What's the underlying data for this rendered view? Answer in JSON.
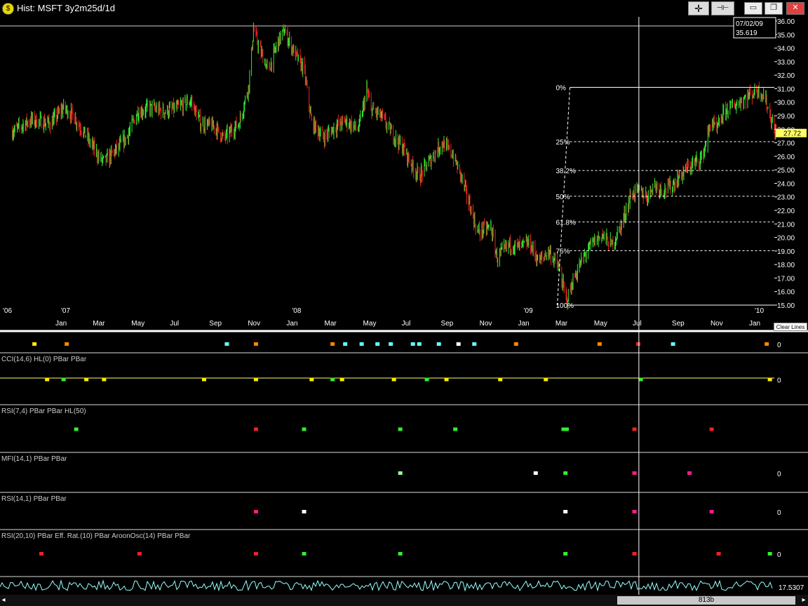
{
  "window": {
    "title": "Hist: MSFT 3y2m25d/1d",
    "btn_crosshair": "✛",
    "btn_pin": "⊣⊢",
    "btn_min": "▭",
    "btn_restore": "❐",
    "btn_close": "✕"
  },
  "cursor": {
    "date": "07/02/09",
    "value": "35.619"
  },
  "clear_lines_label": "Clear Lines",
  "scroll": {
    "left_arrow": "◂",
    "right_arrow": "▸",
    "bar_count": "813b"
  },
  "colors": {
    "up": "#33ee33",
    "down": "#ee2222",
    "price_label": "#ffff66",
    "grid": "#ffffff"
  },
  "chart_data": [
    {
      "type": "candlestick",
      "title": "",
      "series": [
        {
          "name": "MSFT",
          "points": [
            [
              "2006-10-15",
              27.8
            ],
            [
              "2006-11-15",
              28.7
            ],
            [
              "2006-12-15",
              28.4
            ],
            [
              "2007-01-05",
              29.6
            ],
            [
              "2007-01-20",
              29.0
            ],
            [
              "2007-02-10",
              27.5
            ],
            [
              "2007-03-01",
              26.0
            ],
            [
              "2007-03-10",
              25.6
            ],
            [
              "2007-04-01",
              26.6
            ],
            [
              "2007-04-15",
              27.4
            ],
            [
              "2007-05-01",
              29.2
            ],
            [
              "2007-05-20",
              29.6
            ],
            [
              "2007-06-15",
              29.3
            ],
            [
              "2007-07-05",
              29.6
            ],
            [
              "2007-07-25",
              30.1
            ],
            [
              "2007-08-10",
              28.4
            ],
            [
              "2007-09-01",
              28.2
            ],
            [
              "2007-09-15",
              27.3
            ],
            [
              "2007-10-10",
              28.5
            ],
            [
              "2007-10-25",
              31.3
            ],
            [
              "2007-11-01",
              35.4
            ],
            [
              "2007-11-10",
              34.0
            ],
            [
              "2007-11-25",
              32.3
            ],
            [
              "2007-12-10",
              34.5
            ],
            [
              "2007-12-20",
              35.3
            ],
            [
              "2008-01-05",
              33.6
            ],
            [
              "2008-01-20",
              32.4
            ],
            [
              "2008-02-01",
              28.5
            ],
            [
              "2008-02-20",
              27.4
            ],
            [
              "2008-03-10",
              28.2
            ],
            [
              "2008-03-25",
              28.6
            ],
            [
              "2008-04-15",
              28.0
            ],
            [
              "2008-04-28",
              30.9
            ],
            [
              "2008-05-05",
              29.5
            ],
            [
              "2008-05-20",
              29.0
            ],
            [
              "2008-06-10",
              27.5
            ],
            [
              "2008-06-25",
              26.6
            ],
            [
              "2008-07-10",
              25.2
            ],
            [
              "2008-07-20",
              24.5
            ],
            [
              "2008-08-10",
              26.0
            ],
            [
              "2008-08-25",
              27.0
            ],
            [
              "2008-09-10",
              26.2
            ],
            [
              "2008-09-25",
              24.4
            ],
            [
              "2008-10-10",
              22.0
            ],
            [
              "2008-10-20",
              20.4
            ],
            [
              "2008-11-10",
              20.8
            ],
            [
              "2008-11-20",
              18.5
            ],
            [
              "2008-12-10",
              19.5
            ],
            [
              "2008-12-25",
              19.3
            ],
            [
              "2009-01-10",
              19.6
            ],
            [
              "2009-01-25",
              18.2
            ],
            [
              "2009-02-10",
              19.0
            ],
            [
              "2009-02-25",
              17.8
            ],
            [
              "2009-03-10",
              15.3
            ],
            [
              "2009-03-20",
              16.8
            ],
            [
              "2009-04-05",
              18.5
            ],
            [
              "2009-04-20",
              19.6
            ],
            [
              "2009-05-05",
              20.2
            ],
            [
              "2009-05-20",
              19.4
            ],
            [
              "2009-06-05",
              21.0
            ],
            [
              "2009-06-20",
              23.2
            ],
            [
              "2009-07-02",
              23.5
            ],
            [
              "2009-07-15",
              23.0
            ],
            [
              "2009-07-25",
              23.9
            ],
            [
              "2009-08-10",
              23.5
            ],
            [
              "2009-08-25",
              23.9
            ],
            [
              "2009-09-10",
              24.8
            ],
            [
              "2009-09-25",
              25.4
            ],
            [
              "2009-10-10",
              25.9
            ],
            [
              "2009-10-25",
              28.7
            ],
            [
              "2009-11-01",
              27.8
            ],
            [
              "2009-11-15",
              29.4
            ],
            [
              "2009-12-01",
              29.8
            ],
            [
              "2009-12-20",
              30.4
            ],
            [
              "2010-01-05",
              30.9
            ],
            [
              "2010-01-15",
              30.6
            ],
            [
              "2010-01-25",
              29.1
            ],
            [
              "2010-02-01",
              27.9
            ],
            [
              "2010-02-05",
              27.72
            ]
          ]
        }
      ],
      "ylim": [
        15.0,
        36.0
      ],
      "y_ticks": [
        "15.00",
        "16.00",
        "17.00",
        "18.00",
        "19.00",
        "20.00",
        "21.00",
        "22.00",
        "23.00",
        "24.00",
        "25.00",
        "26.00",
        "27.00",
        "28.00",
        "29.00",
        "30.00",
        "31.00",
        "32.00",
        "33.00",
        "34.00",
        "35.00",
        "36.00"
      ],
      "x_ticks": [
        {
          "date": "2006-10-01",
          "year": "'06",
          "month": ""
        },
        {
          "date": "2007-01-01",
          "year": "'07",
          "month": "Jan"
        },
        {
          "date": "2007-03-01",
          "year": "",
          "month": "Mar"
        },
        {
          "date": "2007-05-01",
          "year": "",
          "month": "May"
        },
        {
          "date": "2007-07-01",
          "year": "",
          "month": "Jul"
        },
        {
          "date": "2007-09-01",
          "year": "",
          "month": "Sep"
        },
        {
          "date": "2007-11-01",
          "year": "",
          "month": "Nov"
        },
        {
          "date": "2008-01-01",
          "year": "'08",
          "month": "Jan"
        },
        {
          "date": "2008-03-01",
          "year": "",
          "month": "Mar"
        },
        {
          "date": "2008-05-01",
          "year": "",
          "month": "May"
        },
        {
          "date": "2008-07-01",
          "year": "",
          "month": "Jul"
        },
        {
          "date": "2008-09-01",
          "year": "",
          "month": "Sep"
        },
        {
          "date": "2008-11-01",
          "year": "",
          "month": "Nov"
        },
        {
          "date": "2009-01-01",
          "year": "'09",
          "month": "Jan"
        },
        {
          "date": "2009-03-01",
          "year": "",
          "month": "Mar"
        },
        {
          "date": "2009-05-01",
          "year": "",
          "month": "May"
        },
        {
          "date": "2009-07-01",
          "year": "",
          "month": "Jul"
        },
        {
          "date": "2009-09-01",
          "year": "",
          "month": "Sep"
        },
        {
          "date": "2009-11-01",
          "year": "",
          "month": "Nov"
        },
        {
          "date": "2010-01-01",
          "year": "'10",
          "month": "Jan"
        }
      ],
      "last_price": "27.72",
      "cursor_date": "2009-07-02",
      "fibonacci": {
        "start_date": "2009-03-15",
        "high": 31.1,
        "low": 15.0,
        "levels": [
          {
            "label": "0%",
            "value": 31.1
          },
          {
            "label": "25%",
            "value": 27.08
          },
          {
            "label": "38.2%",
            "value": 24.95
          },
          {
            "label": "50%",
            "value": 23.05
          },
          {
            "label": "61.8%",
            "value": 21.15
          },
          {
            "label": "75%",
            "value": 19.02
          },
          {
            "label": "100%",
            "value": 15.0
          }
        ]
      }
    }
  ],
  "indicators": [
    {
      "label": "",
      "zero": "0",
      "markers": [
        {
          "date": "2006-11-20",
          "color": "#ffee00"
        },
        {
          "date": "2007-01-10",
          "color": "#ff8800"
        },
        {
          "date": "2007-09-20",
          "color": "#66ffff"
        },
        {
          "date": "2007-11-05",
          "color": "#ff8800"
        },
        {
          "date": "2008-03-05",
          "color": "#ff8800"
        },
        {
          "date": "2008-03-25",
          "color": "#66ffff"
        },
        {
          "date": "2008-04-20",
          "color": "#66ffff"
        },
        {
          "date": "2008-05-15",
          "color": "#66ffff"
        },
        {
          "date": "2008-06-05",
          "color": "#66ffff"
        },
        {
          "date": "2008-07-10",
          "color": "#66ffff"
        },
        {
          "date": "2008-07-20",
          "color": "#66ffff"
        },
        {
          "date": "2008-08-20",
          "color": "#66ffff"
        },
        {
          "date": "2008-09-20",
          "color": "#ffffff"
        },
        {
          "date": "2008-10-15",
          "color": "#66ffff"
        },
        {
          "date": "2008-12-20",
          "color": "#ff8800"
        },
        {
          "date": "2009-05-01",
          "color": "#ff8800"
        },
        {
          "date": "2009-07-01",
          "color": "#ff2222"
        },
        {
          "date": "2009-08-25",
          "color": "#66ffff"
        },
        {
          "date": "2010-01-20",
          "color": "#ff8800"
        }
      ]
    },
    {
      "label": "CCI(14,6)  HL(0)  PBar  PBar",
      "zero": "0",
      "markers": [
        {
          "date": "2006-12-10",
          "color": "#ffee00"
        },
        {
          "date": "2007-01-05",
          "color": "#33ee33"
        },
        {
          "date": "2007-02-10",
          "color": "#ffee00"
        },
        {
          "date": "2007-03-10",
          "color": "#ffee00"
        },
        {
          "date": "2007-08-15",
          "color": "#ffee00"
        },
        {
          "date": "2007-11-05",
          "color": "#ffee00"
        },
        {
          "date": "2008-02-01",
          "color": "#ffee00"
        },
        {
          "date": "2008-03-05",
          "color": "#33ee33"
        },
        {
          "date": "2008-03-20",
          "color": "#ffee00"
        },
        {
          "date": "2008-06-10",
          "color": "#ffee00"
        },
        {
          "date": "2008-08-01",
          "color": "#33ee33"
        },
        {
          "date": "2008-09-01",
          "color": "#ffee00"
        },
        {
          "date": "2008-11-25",
          "color": "#ffee00"
        },
        {
          "date": "2009-02-05",
          "color": "#ffee00"
        },
        {
          "date": "2009-07-05",
          "color": "#33ee33"
        },
        {
          "date": "2010-01-25",
          "color": "#ffee00"
        }
      ]
    },
    {
      "label": "RSI(7,4)  PBar  PBar  HL(50)",
      "zero": "",
      "markers": [
        {
          "date": "2007-01-25",
          "color": "#33ee33"
        },
        {
          "date": "2007-11-05",
          "color": "#ee2222"
        },
        {
          "date": "2008-01-20",
          "color": "#33ee33"
        },
        {
          "date": "2008-06-20",
          "color": "#33ee33"
        },
        {
          "date": "2008-09-15",
          "color": "#33ee33"
        },
        {
          "date": "2009-03-05",
          "color": "#33ee33"
        },
        {
          "date": "2009-03-10",
          "color": "#33ee33"
        },
        {
          "date": "2009-06-25",
          "color": "#ee2222"
        },
        {
          "date": "2009-10-25",
          "color": "#ee2222"
        }
      ]
    },
    {
      "label": "MFI(14,1)  PBar  PBar",
      "zero": "0",
      "markers": [
        {
          "date": "2008-06-20",
          "color": "#99ff99"
        },
        {
          "date": "2009-01-20",
          "color": "#ffffff"
        },
        {
          "date": "2009-03-08",
          "color": "#33ee33"
        },
        {
          "date": "2009-06-25",
          "color": "#ff1a8c"
        },
        {
          "date": "2009-09-20",
          "color": "#ff1a8c"
        }
      ]
    },
    {
      "label": "RSI(14,1)  PBar  PBar",
      "zero": "0",
      "markers": [
        {
          "date": "2007-11-05",
          "color": "#ff1a8c"
        },
        {
          "date": "2008-01-20",
          "color": "#ffffff"
        },
        {
          "date": "2009-03-08",
          "color": "#ffffff"
        },
        {
          "date": "2009-06-25",
          "color": "#ff1a8c"
        },
        {
          "date": "2009-10-25",
          "color": "#ff1a8c"
        }
      ]
    },
    {
      "label": "RSI(20,10)  PBar  Eff. Rat.(10)  PBar  AroonOsc(14)  PBar  PBar",
      "zero": "0",
      "markers": [
        {
          "date": "2006-12-01",
          "color": "#ee2222"
        },
        {
          "date": "2007-05-05",
          "color": "#ee2222"
        },
        {
          "date": "2007-11-05",
          "color": "#ee2222"
        },
        {
          "date": "2008-01-20",
          "color": "#33ee33"
        },
        {
          "date": "2008-06-20",
          "color": "#33ee33"
        },
        {
          "date": "2009-03-08",
          "color": "#33ee33"
        },
        {
          "date": "2009-06-25",
          "color": "#ee2222"
        },
        {
          "date": "2009-11-05",
          "color": "#ee2222"
        },
        {
          "date": "2010-01-25",
          "color": "#33ee33"
        }
      ]
    },
    {
      "label": "",
      "zero": "17.5307",
      "markers": []
    }
  ]
}
